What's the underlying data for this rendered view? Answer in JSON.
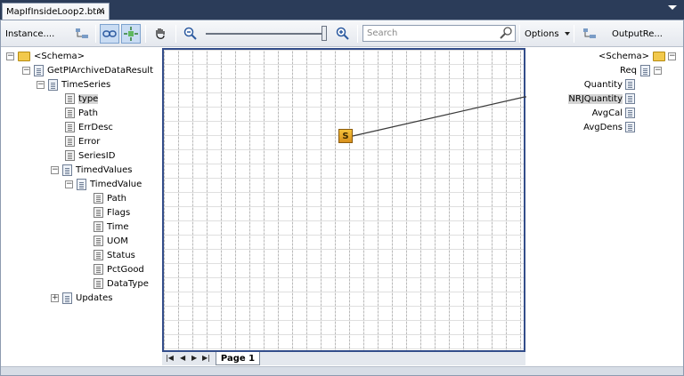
{
  "document_tab": {
    "title": "MapIfInsideLoop2.btm",
    "close": "✕"
  },
  "toolbar": {
    "instance_label": "Instance....",
    "search_placeholder": "Search",
    "options_label": "Options",
    "output_label": "OutputRe..."
  },
  "source_tree": [
    {
      "label": "<Schema>"
    },
    {
      "label": "GetPIArchiveDataResult"
    },
    {
      "label": "TimeSeries"
    },
    {
      "label": "type"
    },
    {
      "label": "Path"
    },
    {
      "label": "ErrDesc"
    },
    {
      "label": "Error"
    },
    {
      "label": "SeriesID"
    },
    {
      "label": "TimedValues"
    },
    {
      "label": "TimedValue"
    },
    {
      "label": "Path"
    },
    {
      "label": "Flags"
    },
    {
      "label": "Time"
    },
    {
      "label": "UOM"
    },
    {
      "label": "Status"
    },
    {
      "label": "PctGood"
    },
    {
      "label": "DataType"
    },
    {
      "label": "Updates"
    }
  ],
  "dest_tree": [
    {
      "label": "<Schema>"
    },
    {
      "label": "Req"
    },
    {
      "label": "Quantity"
    },
    {
      "label": "NRJQuantity"
    },
    {
      "label": "AvgCal"
    },
    {
      "label": "AvgDens"
    }
  ],
  "grid": {
    "functoid_symbol": "S"
  },
  "page_tabs": {
    "active": "Page 1"
  },
  "expander_symbols": {
    "collapse": "−",
    "expand": "+"
  }
}
